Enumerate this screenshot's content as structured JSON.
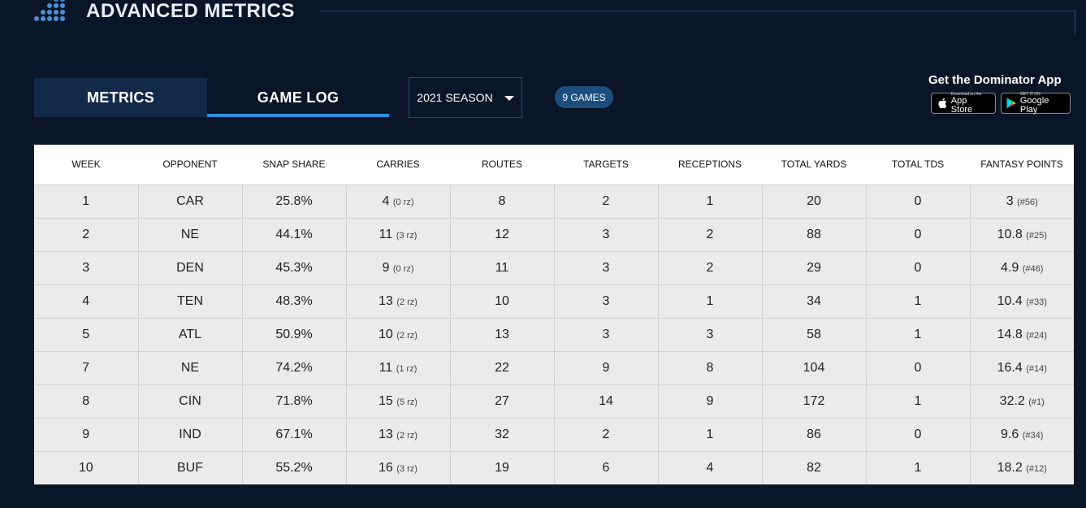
{
  "header": {
    "title": "ADVANCED METRICS"
  },
  "tabs": [
    {
      "label": "METRICS",
      "active": false
    },
    {
      "label": "GAME LOG",
      "active": true
    }
  ],
  "season_select": {
    "value": "2021 SEASON"
  },
  "games_badge": "9 GAMES",
  "app_promo": {
    "title": "Get the Dominator App",
    "apple": {
      "small": "Download on the",
      "big": "App Store"
    },
    "google": {
      "small": "GET IT ON",
      "big": "Google Play"
    }
  },
  "colors": {
    "background": "#0a1628",
    "accent": "#2e8fe0",
    "badge": "#1b4e7e"
  },
  "table": {
    "columns": [
      "WEEK",
      "OPPONENT",
      "SNAP SHARE",
      "CARRIES",
      "ROUTES",
      "TARGETS",
      "RECEPTIONS",
      "TOTAL YARDS",
      "TOTAL TDS",
      "FANTASY POINTS"
    ],
    "rows": [
      {
        "week": "1",
        "opp": "CAR",
        "snap": "25.8%",
        "carries": "4",
        "rz": "(0 rz)",
        "routes": "8",
        "targets": "2",
        "rec": "1",
        "yards": "20",
        "tds": "0",
        "fp": "3",
        "rank": "(#56)"
      },
      {
        "week": "2",
        "opp": "NE",
        "snap": "44.1%",
        "carries": "11",
        "rz": "(3 rz)",
        "routes": "12",
        "targets": "3",
        "rec": "2",
        "yards": "88",
        "tds": "0",
        "fp": "10.8",
        "rank": "(#25)"
      },
      {
        "week": "3",
        "opp": "DEN",
        "snap": "45.3%",
        "carries": "9",
        "rz": "(0 rz)",
        "routes": "11",
        "targets": "3",
        "rec": "2",
        "yards": "29",
        "tds": "0",
        "fp": "4.9",
        "rank": "(#46)"
      },
      {
        "week": "4",
        "opp": "TEN",
        "snap": "48.3%",
        "carries": "13",
        "rz": "(2 rz)",
        "routes": "10",
        "targets": "3",
        "rec": "1",
        "yards": "34",
        "tds": "1",
        "fp": "10.4",
        "rank": "(#33)"
      },
      {
        "week": "5",
        "opp": "ATL",
        "snap": "50.9%",
        "carries": "10",
        "rz": "(2 rz)",
        "routes": "13",
        "targets": "3",
        "rec": "3",
        "yards": "58",
        "tds": "1",
        "fp": "14.8",
        "rank": "(#24)"
      },
      {
        "week": "7",
        "opp": "NE",
        "snap": "74.2%",
        "carries": "11",
        "rz": "(1 rz)",
        "routes": "22",
        "targets": "9",
        "rec": "8",
        "yards": "104",
        "tds": "0",
        "fp": "16.4",
        "rank": "(#14)"
      },
      {
        "week": "8",
        "opp": "CIN",
        "snap": "71.8%",
        "carries": "15",
        "rz": "(5 rz)",
        "routes": "27",
        "targets": "14",
        "rec": "9",
        "yards": "172",
        "tds": "1",
        "fp": "32.2",
        "rank": "(#1)"
      },
      {
        "week": "9",
        "opp": "IND",
        "snap": "67.1%",
        "carries": "13",
        "rz": "(2 rz)",
        "routes": "32",
        "targets": "2",
        "rec": "1",
        "yards": "86",
        "tds": "0",
        "fp": "9.6",
        "rank": "(#34)"
      },
      {
        "week": "10",
        "opp": "BUF",
        "snap": "55.2%",
        "carries": "16",
        "rz": "(3 rz)",
        "routes": "19",
        "targets": "6",
        "rec": "4",
        "yards": "82",
        "tds": "1",
        "fp": "18.2",
        "rank": "(#12)"
      }
    ]
  }
}
